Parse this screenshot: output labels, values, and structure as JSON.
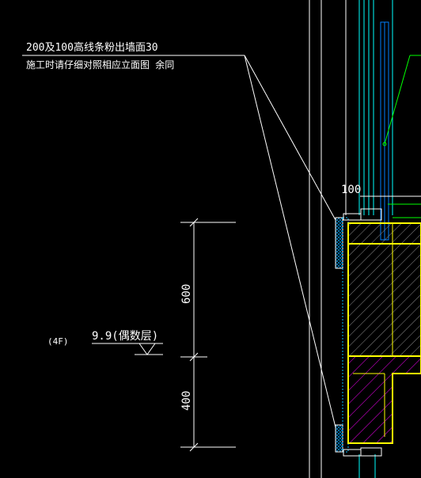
{
  "annotation": {
    "line1": "200及100高线条粉出墙面30",
    "line2": "施工时请仔细对照相应立面图  余同"
  },
  "dimension_labels": {
    "top_width": "100",
    "upper_height": "600",
    "lower_height": "400"
  },
  "level_marker": {
    "floor": "(4F)",
    "elevation": "9.9(偶数层)"
  },
  "colors": {
    "background": "#000000",
    "linework": "#ffffff",
    "wall_outline": "#ffff00",
    "glazing": "#00ffff",
    "pipe": "#0080ff",
    "hatch_concrete": "#808080",
    "hatch_rebar": "#ff00ff",
    "leader": "#00ff00",
    "insulation": "#00bfff"
  }
}
